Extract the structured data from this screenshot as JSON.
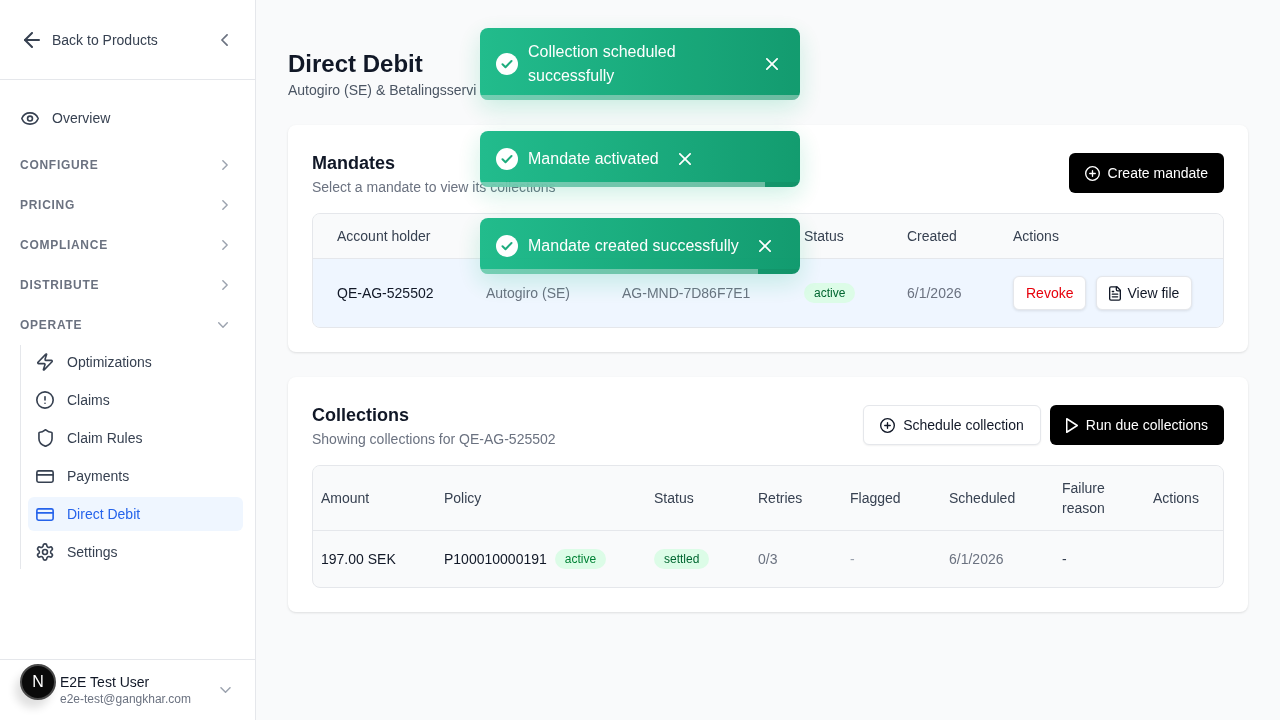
{
  "sidebar": {
    "back_label": "Back to Products",
    "overview": {
      "label": "Overview",
      "selected": false
    },
    "sections": [
      {
        "label": "CONFIGURE",
        "expanded": false
      },
      {
        "label": "PRICING",
        "expanded": false
      },
      {
        "label": "COMPLIANCE",
        "expanded": false
      },
      {
        "label": "DISTRIBUTE",
        "expanded": false
      },
      {
        "label": "OPERATE",
        "expanded": true,
        "children": [
          {
            "label": "Optimizations",
            "selected": false
          },
          {
            "label": "Claims",
            "selected": false
          },
          {
            "label": "Claim Rules",
            "selected": false
          },
          {
            "label": "Payments",
            "selected": false
          },
          {
            "label": "Direct Debit",
            "selected": true
          },
          {
            "label": "Settings",
            "selected": false
          }
        ]
      }
    ],
    "user": {
      "name": "E2E Test User",
      "email": "e2e-test@gangkhar.com"
    }
  },
  "dev_badge": {
    "label": "N"
  },
  "page": {
    "title": "Direct Debit",
    "subtitle": "Autogiro (SE) & Betalingsservi"
  },
  "mandates": {
    "title": "Mandates",
    "subtitle": "Select a mandate to view its collections",
    "create_button": "Create mandate",
    "table": {
      "columns": [
        "Account holder",
        "Status",
        "Created",
        "Actions"
      ],
      "rows": [
        {
          "selected": true,
          "account_holder": "QE-AG-525502",
          "column_2": "Autogiro (SE)",
          "column_3": "AG-MND-7D86F7E1",
          "status": "active",
          "created": "6/1/2026",
          "actions": [
            {
              "kind": "danger",
              "label": "Revoke"
            },
            {
              "kind": "file",
              "label": "View file"
            }
          ]
        }
      ]
    }
  },
  "collections": {
    "title": "Collections",
    "subtitle": "Showing collections for QE-AG-525502",
    "buttons": [
      {
        "kind": "secondary",
        "label": "Schedule collection"
      },
      {
        "kind": "primary",
        "label": "Run due collections"
      }
    ],
    "table": {
      "columns": [
        "Amount",
        "Policy",
        "Status",
        "Retries",
        "Flagged",
        "Scheduled",
        "Failure reason",
        "Actions"
      ],
      "rows": [
        {
          "amount": "197.00 SEK",
          "policy": "P100010000191",
          "policy_status": "active",
          "status": "settled",
          "retries": "0/3",
          "flagged": "-",
          "scheduled": "6/1/2026",
          "failure_reason": "-"
        }
      ]
    }
  },
  "toasts": [
    {
      "message": "Collection scheduled successfully",
      "level": 1
    },
    {
      "message": "Mandate activated",
      "level": 0.89
    },
    {
      "message": "Mandate created successfully",
      "level": 0.87
    }
  ]
}
